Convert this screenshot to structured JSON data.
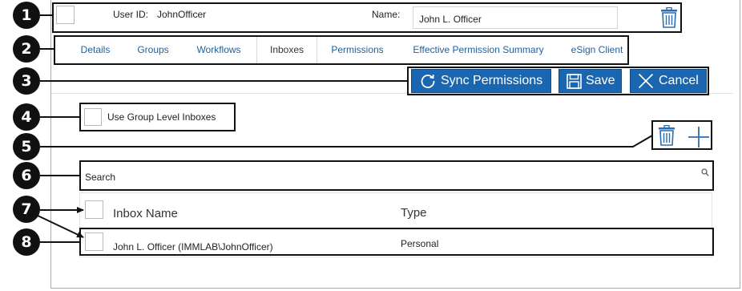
{
  "header": {
    "user_id_label": "User ID:",
    "user_id_value": "JohnOfficer",
    "name_label": "Name:",
    "name_value": "John L. Officer"
  },
  "tabs": [
    {
      "label": "Details"
    },
    {
      "label": "Groups"
    },
    {
      "label": "Workflows"
    },
    {
      "label": "Inboxes",
      "active": true
    },
    {
      "label": "Permissions"
    },
    {
      "label": "Effective Permission Summary"
    },
    {
      "label": "eSign Client"
    }
  ],
  "actions": {
    "sync_label": "Sync Permissions",
    "save_label": "Save",
    "cancel_label": "Cancel"
  },
  "options": {
    "use_group_level_label": "Use Group Level Inboxes"
  },
  "search": {
    "placeholder": "Search"
  },
  "table": {
    "columns": [
      "Inbox Name",
      "Type"
    ],
    "rows": [
      {
        "name": "John L. Officer (IMMLAB\\JohnOfficer)",
        "type": "Personal"
      }
    ]
  },
  "callouts": [
    "1",
    "2",
    "3",
    "4",
    "5",
    "6",
    "7",
    "8"
  ],
  "colors": {
    "accent": "#1b66b0",
    "tab_text": "#1f5f9c",
    "icon_blue": "#2a6db3"
  },
  "icons": [
    "trash-icon",
    "plus-icon",
    "sync-icon",
    "save-icon",
    "close-icon",
    "search-icon"
  ]
}
